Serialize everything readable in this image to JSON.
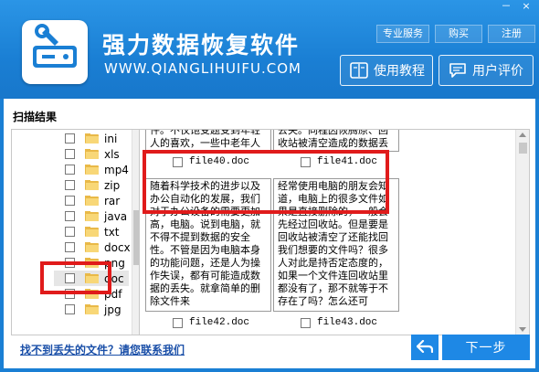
{
  "app": {
    "title": "强力数据恢复软件",
    "url": "WWW.QIANGLIHUIFU.COM",
    "logo_icon": "hard-drive-wrench-icon"
  },
  "window_controls": {
    "minimize": "－",
    "close": "×"
  },
  "top_links": [
    "专业服务",
    "购买",
    "注册"
  ],
  "header_buttons": {
    "tutorial": {
      "label": "使用教程",
      "icon": "book-icon"
    },
    "review": {
      "label": "用户评价",
      "icon": "chat-icon"
    }
  },
  "scan": {
    "title": "扫描结果"
  },
  "tree": {
    "items": [
      {
        "label": "ini"
      },
      {
        "label": "xls"
      },
      {
        "label": "mp4"
      },
      {
        "label": "zip"
      },
      {
        "label": "rar"
      },
      {
        "label": "java"
      },
      {
        "label": "txt"
      },
      {
        "label": "docx"
      },
      {
        "label": "png"
      },
      {
        "label": "doc"
      },
      {
        "label": "pdf"
      },
      {
        "label": "jpg"
      }
    ]
  },
  "files": [
    {
      "name": "file40.doc",
      "preview": "件。不仅饱受题受到年轻人的喜欢，一些中老年人也都开始了解一些微信"
    },
    {
      "name": "file41.doc",
      "preview": "去失。同程因恢腾原、回收站被清空造成的数据丢失。"
    },
    {
      "name": "file42.doc",
      "preview": "随着科学技术的进步以及办公自动化的发展，我们对于办公设备的需要更加高，电脑。说到电脑，就不得不提到数据的安全性。不管是因为电脑本身的功能问题，还是人为操作失误，都有可能造成数据的丢失。就拿简单的删除文件来"
    },
    {
      "name": "file43.doc",
      "preview": "经常使用电脑的朋友会知道，电脑上的很多文件如果是直接删除的，一般会先经过回收站。但是要是回收站被清空了还能找回我们想要的文件吗？很多人对此是持否定态度的，如果一个文件连回收站里都没有了，那不就等于不存在了吗？怎么还可"
    }
  ],
  "footer": {
    "contact_link": "找不到丢失的文件？请您联系我们",
    "back_icon": "back-arrow-icon",
    "next_label": "下一步"
  },
  "colors": {
    "header_blue": "#1a7fd4",
    "button_blue": "#1e88e5",
    "highlight_red": "#e01b1b",
    "link_blue": "#1a4fa8"
  }
}
